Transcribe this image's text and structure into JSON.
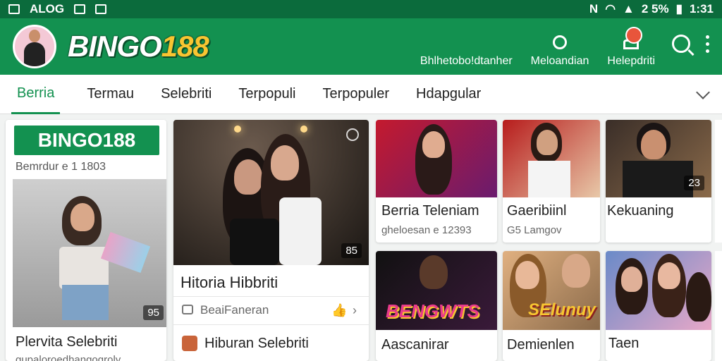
{
  "status_bar": {
    "left_text": "ALOG",
    "battery": "2 5%",
    "time": "1:31"
  },
  "app": {
    "logo_text": "BINGO",
    "logo_number": "188"
  },
  "actions": [
    {
      "label": "Bhlhetobo!dtanher",
      "icon": "notification-icon"
    },
    {
      "label": "Meloandian",
      "icon": "chat-icon"
    },
    {
      "label": "Helepdriti",
      "icon": "cake-icon"
    }
  ],
  "tabs": [
    "Berria",
    "Termau",
    "Selebriti",
    "Terpopuli",
    "Terpopuler",
    "Hdapgular"
  ],
  "left_card": {
    "brand": "BINGO188",
    "meta": "Bemrdur e 1 1803",
    "count": "95",
    "title": "Plervita Selebriti",
    "sub": "gupaloroedhangogroly"
  },
  "mid_card": {
    "count": "85",
    "title": "Hitoria Hibbriti",
    "action_label": "BeaiFaneran",
    "footer_title": "Hiburan Selebriti"
  },
  "grid": [
    {
      "title": "Berria Teleniam",
      "sub": "gheloesan e 12393",
      "count": ""
    },
    {
      "title": "Gaeribiinl",
      "sub": "G5 Lamgov",
      "count": ""
    },
    {
      "title": "Kekuaning",
      "sub": "",
      "count": "23"
    },
    {
      "title": "Aascanirar",
      "sub": "",
      "count": "",
      "banner": "BENGWTS"
    },
    {
      "title": "Demienlen",
      "sub": "",
      "count": "",
      "banner": "SElunuy"
    },
    {
      "title": "Taen",
      "sub": "",
      "count": ""
    }
  ],
  "colors": {
    "primary": "#139150",
    "status": "#0b6b3c",
    "accent": "#f7c531"
  }
}
